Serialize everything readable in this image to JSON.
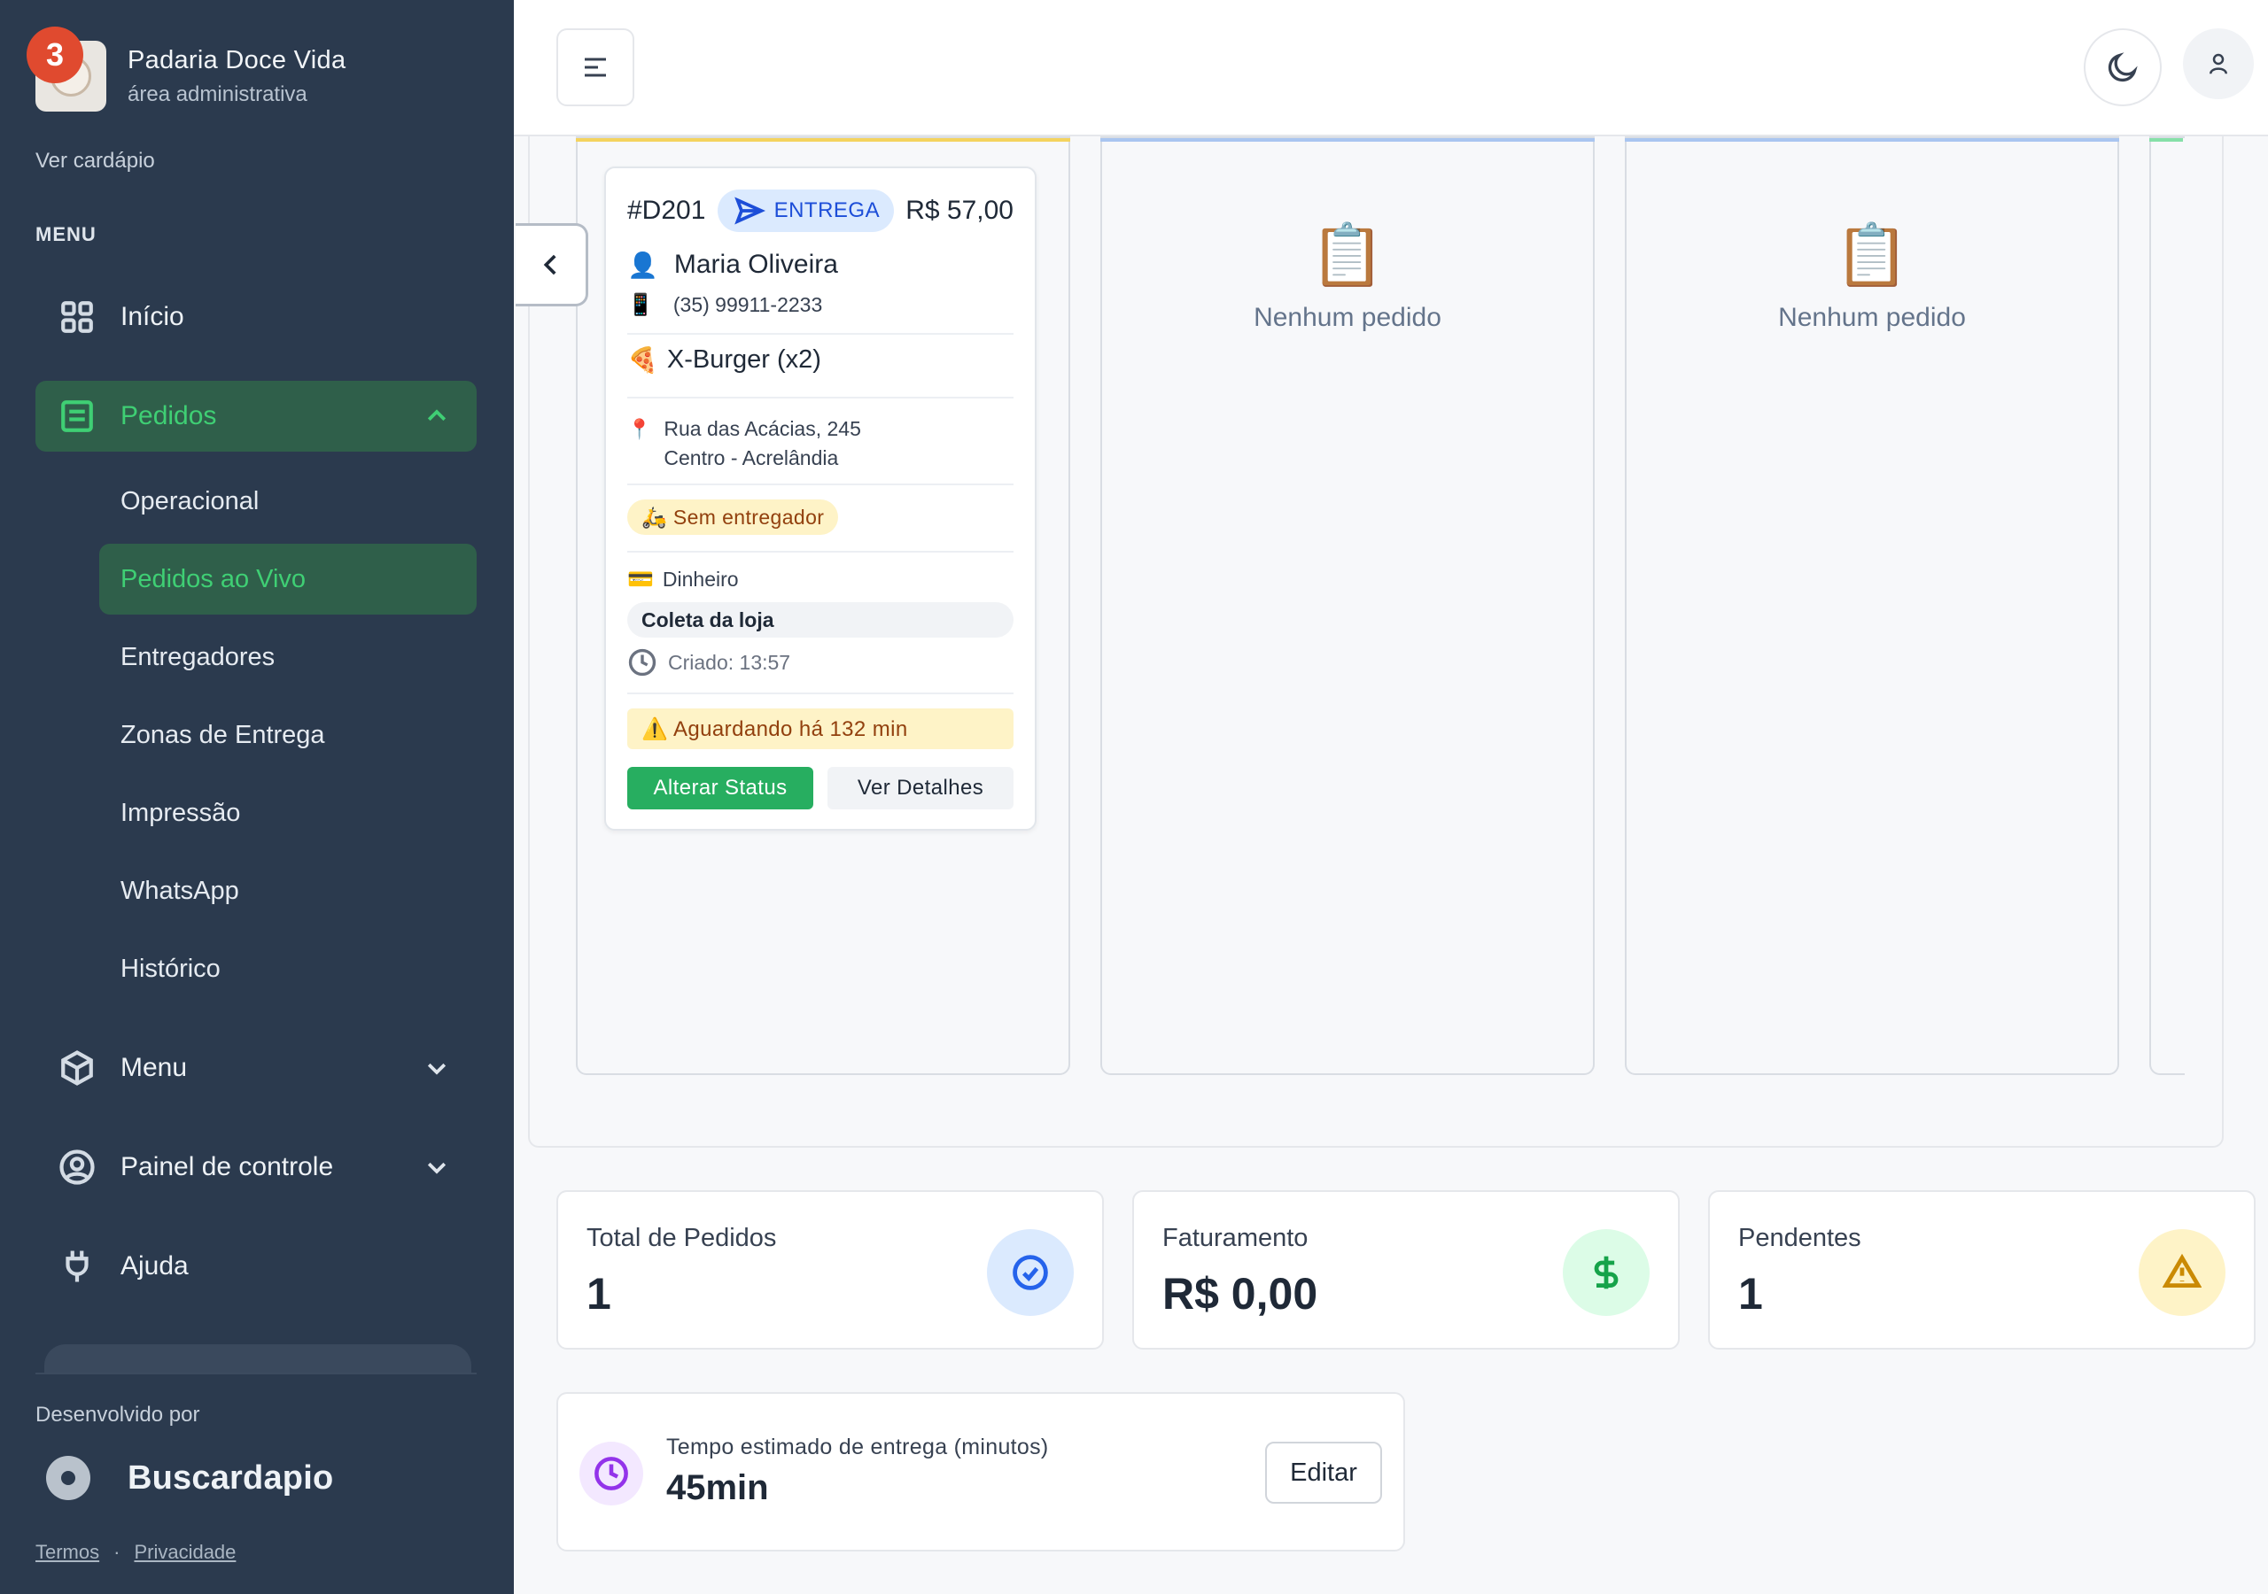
{
  "brand": {
    "name": "Padaria Doce Vida",
    "subtitle": "área administrativa",
    "notification_count": "3"
  },
  "sidebar": {
    "view_menu_link": "Ver cardápio",
    "menu_heading": "MENU",
    "items": {
      "inicio": "Início",
      "pedidos": "Pedidos",
      "menu": "Menu",
      "painel": "Painel de controle",
      "ajuda": "Ajuda"
    },
    "pedidos_sub": {
      "operacional": "Operacional",
      "ao_vivo": "Pedidos ao Vivo",
      "entregadores": "Entregadores",
      "zonas": "Zonas de Entrega",
      "impressao": "Impressão",
      "whatsapp": "WhatsApp",
      "historico": "Histórico"
    },
    "developed_by": "Desenvolvido por",
    "developer_name": "Buscardapio",
    "terms": "Termos",
    "separator": "·",
    "privacy": "Privacidade"
  },
  "board": {
    "empty_icon": "📋",
    "empty_text": "Nenhum pedido",
    "column_colors": [
      "#f4d35e",
      "#a9c5f0",
      "#a9c5f0",
      "#86e0a8"
    ]
  },
  "order": {
    "id": "#D201",
    "type": "ENTREGA",
    "price": "R$ 57,00",
    "customer_icon": "👤",
    "customer": "Maria Oliveira",
    "phone_icon": "📱",
    "phone": "(35) 99911-2233",
    "item_icon": "🍕",
    "item": "X-Burger (x2)",
    "address_icon": "📍",
    "address_line1": "Rua das Acácias, 245",
    "address_line2": "Centro - Acrelândia",
    "courier_status": "🛵 Sem entregador",
    "payment_icon": "💳",
    "payment": "Dinheiro",
    "pickup": "Coleta da loja",
    "created": "Criado: 13:57",
    "waiting": "⚠️ Aguardando há 132 min",
    "status_button": "Alterar Status",
    "details_button": "Ver Detalhes"
  },
  "stats": {
    "total": {
      "label": "Total de Pedidos",
      "value": "1",
      "icon": "check-circle-icon",
      "bg": "#dbeafe",
      "color": "#2563eb"
    },
    "revenue": {
      "label": "Faturamento",
      "value": "R$ 0,00",
      "icon": "dollar-icon",
      "bg": "#dcfce7",
      "color": "#16a34a"
    },
    "pending": {
      "label": "Pendentes",
      "value": "1",
      "icon": "warning-icon",
      "bg": "#fef3c7",
      "color": "#ca8a04"
    }
  },
  "eta": {
    "label": "Tempo estimado de entrega (minutos)",
    "value": "45min",
    "edit_button": "Editar"
  }
}
